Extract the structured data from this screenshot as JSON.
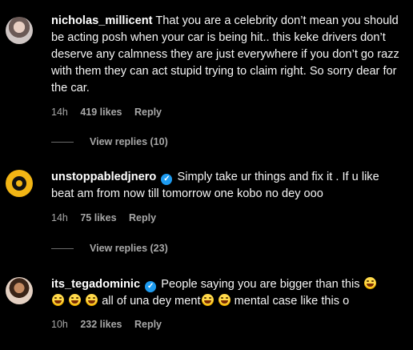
{
  "comments": [
    {
      "username": "nicholas_millicent",
      "verified": false,
      "text": "That you are a celebrity don’t mean you should be acting posh when your car is being hit.. this keke drivers don’t deserve any calmness they are just everywhere if you don’t go razz with them they can act stupid trying to claim right. So sorry dear for the car.",
      "time": "14h",
      "likes": "419 likes",
      "reply_label": "Reply",
      "view_replies": "View replies (10)"
    },
    {
      "username": "unstoppabledjnero",
      "verified": true,
      "text": "Simply take ur things and fix it . If u like beat am from now till tomorrow one kobo no dey ooo",
      "time": "14h",
      "likes": "75 likes",
      "reply_label": "Reply",
      "view_replies": "View replies (23)"
    },
    {
      "username": "its_tegadominic",
      "verified": true,
      "text_parts": [
        "People saying you are bigger than this",
        "all of una dey ment",
        "mental case like this o"
      ],
      "emojis": "laughing-face-emoji",
      "time": "10h",
      "likes": "232 likes",
      "reply_label": "Reply"
    }
  ]
}
